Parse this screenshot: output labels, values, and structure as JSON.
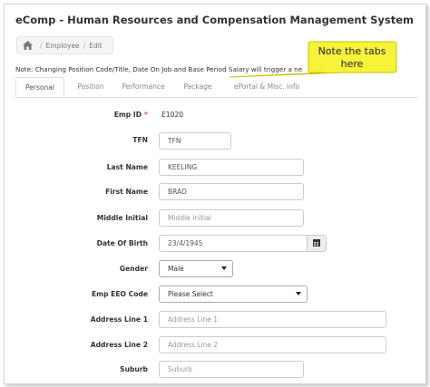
{
  "window": {
    "title": "eComp - Human Resources and Compensation Management System"
  },
  "breadcrumb": {
    "items": [
      "Employee",
      "Edit"
    ],
    "home_icon": "home-icon"
  },
  "note": {
    "text": "Note: Changing Position Code/Title, Date On Job and Base Period Salary will trigger a ne"
  },
  "callout": {
    "line1": "Note the tabs",
    "line2": "here",
    "color": "#f7f23a"
  },
  "tabs": [
    {
      "label": "Personal",
      "active": true
    },
    {
      "label": "Position"
    },
    {
      "label": "Performance"
    },
    {
      "label": "Package"
    },
    {
      "label": "ePortal & Misc. info"
    }
  ],
  "form": {
    "emp_id": {
      "label": "Emp ID",
      "required_mark": "*",
      "value": "E1020"
    },
    "tfn": {
      "label": "TFN",
      "value": "TFN"
    },
    "last_name": {
      "label": "Last Name",
      "value": "KEELING"
    },
    "first_name": {
      "label": "First Name",
      "value": "BRAD"
    },
    "middle_initial": {
      "label": "Middle Initial",
      "placeholder": "Middle Initial"
    },
    "dob": {
      "label": "Date Of Birth",
      "value": "23/4/1945"
    },
    "gender": {
      "label": "Gender",
      "value": "Male"
    },
    "eeo": {
      "label": "Emp EEO Code",
      "value": "Please Select"
    },
    "address1": {
      "label": "Address Line 1",
      "placeholder": "Address Line 1"
    },
    "address2": {
      "label": "Address Line 2",
      "placeholder": "Address Line 2"
    },
    "suburb": {
      "label": "Suburb",
      "placeholder": "Suburb"
    }
  }
}
